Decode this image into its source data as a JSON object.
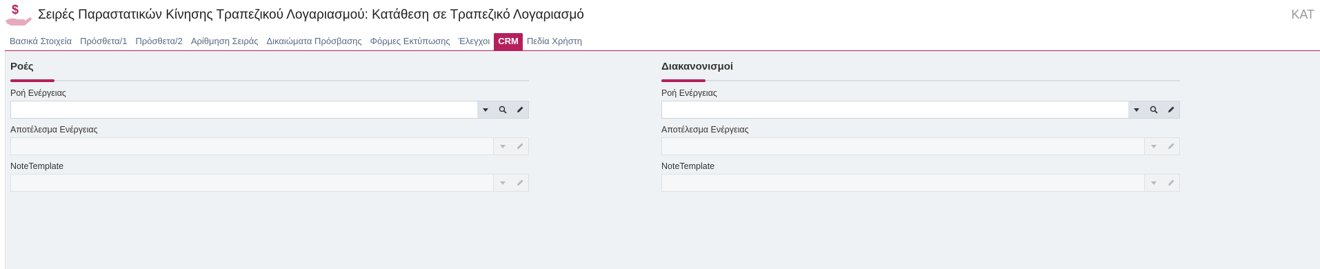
{
  "header": {
    "title": "Σειρές Παραστατικών Κίνησης Τραπεζικού Λογαριασμού: Κατάθεση σε Τραπεζικό Λογαριασμό",
    "code": "ΚΑΤ",
    "icon": "money-hand-icon"
  },
  "tabs": [
    {
      "label": "Βασικά Στοιχεία"
    },
    {
      "label": "Πρόσθετα/1"
    },
    {
      "label": "Πρόσθετα/2"
    },
    {
      "label": "Αρίθμηση Σειράς"
    },
    {
      "label": "Δικαιώματα Πρόσβασης"
    },
    {
      "label": "Φόρμες Εκτύπωσης"
    },
    {
      "label": "Έλεγχοι"
    },
    {
      "label": "CRM",
      "active": true
    },
    {
      "label": "Πεδία Χρήστη"
    }
  ],
  "sections": {
    "left": {
      "title": "Ροές",
      "fields": [
        {
          "label": "Ροή Ενέργειας",
          "value": "",
          "enabled": true
        },
        {
          "label": "Αποτέλεσμα Ενέργειας",
          "value": "",
          "enabled": false
        },
        {
          "label": "NoteTemplate",
          "value": "",
          "enabled": false
        }
      ]
    },
    "right": {
      "title": "Διακανονισμοί",
      "fields": [
        {
          "label": "Ροή Ενέργειας",
          "value": "",
          "enabled": true
        },
        {
          "label": "Αποτέλεσμα Ενέργειας",
          "value": "",
          "enabled": false
        },
        {
          "label": "NoteTemplate",
          "value": "",
          "enabled": false
        }
      ]
    }
  },
  "colors": {
    "accent": "#b51f5c",
    "panel_bg": "#eff2f4",
    "tab_text": "#5a6b80"
  }
}
